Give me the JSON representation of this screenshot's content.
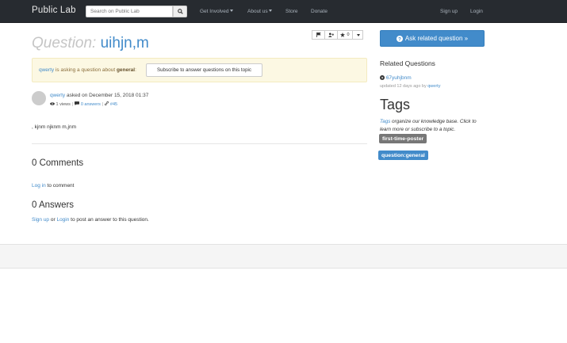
{
  "navbar": {
    "brand": "Public Lab",
    "search_placeholder": "Search on Public Lab",
    "search_icon": "search-icon",
    "items": [
      {
        "label": "Get Involved",
        "has_caret": true
      },
      {
        "label": "About us",
        "has_caret": true
      },
      {
        "label": "Store",
        "has_caret": false
      },
      {
        "label": "Donate",
        "has_caret": false
      }
    ],
    "signup": "Sign up",
    "login": "Login"
  },
  "question": {
    "label": "Question:",
    "title": "uihjn,m",
    "toolbar": {
      "flag_icon": "flag-icon",
      "follow_icon": "user-plus-icon",
      "like_icon": "star-icon",
      "like_count": "0",
      "menu_icon": "caret-down-icon"
    },
    "alert": {
      "user": "qwerty",
      "middle": " is asking a question about ",
      "topic": "general",
      "colon": ":",
      "subscribe": "Subscribe to answer questions on this topic"
    },
    "author": "qwerty",
    "asked_text": " asked on December 15, 2018 01:37",
    "views": "1 views",
    "answers_link": "0 answers",
    "node_id": "#45",
    "body": ", kjnm njknm m,jnm",
    "comments_heading": "0 Comments",
    "login_link": "Log in",
    "login_text": " to comment",
    "answers_heading": "0 Answers",
    "signup_link": "Sign up",
    "or_text": " or ",
    "login2_link": "Login",
    "answer_text": " to post an answer to this question."
  },
  "sidebar": {
    "ask_button": "Ask related question »",
    "related_heading": "Related Questions",
    "related_item": "67yuhjbnm",
    "related_updated": "updated 12 days ago by ",
    "related_user": "qwerty",
    "tags_heading": "Tags",
    "tags_link": "Tags",
    "tags_desc": " organize our knowledge base. Click to learn more or subscribe to a topic.",
    "tags": [
      "first-time-poster",
      "question:general"
    ]
  },
  "colors": {
    "navbar_bg": "#272b30",
    "link": "#428bca",
    "alert_bg": "#fcf8e3",
    "tag_default": "#777777",
    "tag_primary": "#428bca"
  }
}
